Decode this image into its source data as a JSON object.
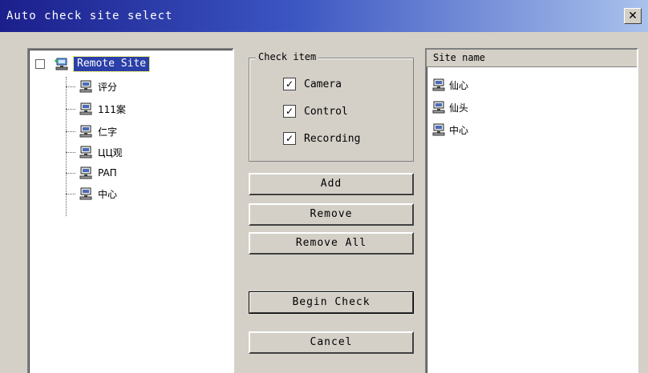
{
  "window": {
    "title": "Auto check site select",
    "close_glyph": "✕"
  },
  "tree": {
    "root_label": "Remote Site",
    "items": [
      {
        "label": "评分"
      },
      {
        "label": "111案"
      },
      {
        "label": "仁字"
      },
      {
        "label": "ЦЦ观"
      },
      {
        "label": "PAП"
      },
      {
        "label": "中心"
      }
    ]
  },
  "check_group": {
    "title": "Check item",
    "items": [
      {
        "label": "Camera",
        "checked": true
      },
      {
        "label": "Control",
        "checked": true
      },
      {
        "label": "Recording",
        "checked": true
      }
    ]
  },
  "buttons": {
    "add": "Add",
    "remove": "Remove",
    "remove_all": "Remove All",
    "begin_check": "Begin Check",
    "cancel": "Cancel"
  },
  "site_list": {
    "header": "Site name",
    "items": [
      {
        "label": "仙心"
      },
      {
        "label": "仙头"
      },
      {
        "label": "中心"
      }
    ]
  },
  "colors": {
    "title_start": "#1b1f8c",
    "title_end": "#a9c2ec",
    "selection": "#2b3fa8"
  }
}
